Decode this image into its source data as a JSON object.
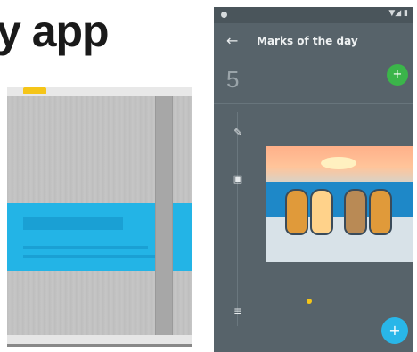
{
  "headline": "y app",
  "phone": {
    "statusbar": {
      "icons": "▼◢ ▮"
    },
    "appbar": {
      "back_icon": "arrow-left-icon",
      "back_glyph": "←",
      "title": "Marks of the day"
    },
    "header": {
      "day_number": "5",
      "subtitle_line1": "",
      "subtitle_line2": ""
    },
    "fab_top": {
      "icon": "add-icon",
      "glyph": "+",
      "color": "#3bb54a"
    },
    "timeline": {
      "pencil_glyph": "✎",
      "photo_glyph": "▣",
      "list_glyph": "≡"
    },
    "fab_bottom": {
      "icon": "add-icon",
      "glyph": "+",
      "color": "#29b6e8"
    }
  },
  "colors": {
    "notebook_band": "#23b4e6",
    "notebook_tab": "#f5c518",
    "phone_bg": "#57636a"
  }
}
